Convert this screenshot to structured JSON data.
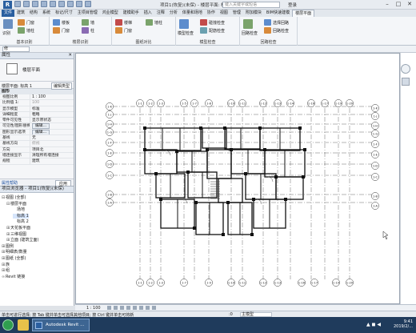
{
  "titlebar": {
    "logo": "R",
    "title": "项目1(恢复)(未保) - 楼层平面: 标高 1",
    "search_placeholder": "键入关键字或短语",
    "login": "登录",
    "min": "–",
    "max": "□",
    "close": "✕"
  },
  "ribbon_tabs": [
    "文件",
    "建筑",
    "结构",
    "系统",
    "插入",
    "注释",
    "分析",
    "体量和场地",
    "协作",
    "视图",
    "管理",
    "附加模块",
    "修改",
    "BIM模型",
    "楼层平面",
    "整合工具",
    "修改 | 楼层平面"
  ],
  "ribbon_tabs_fixed": [
    "文件",
    "建筑",
    "结构",
    "系统",
    "插入",
    "注释",
    "分析",
    "体量和场地",
    "协作",
    "视图",
    "管理",
    "附加模块",
    "修改"
  ],
  "ribbon_tabs_display": [
    "文件",
    "建筑",
    "结构",
    "系统",
    "标记/尺寸",
    "主项目管理",
    "鸿业模型",
    "建模助手",
    "插入",
    "注释",
    "分析",
    "体量和场地",
    "协作",
    "视图",
    "管理",
    "附加模块",
    "BIM快速建模",
    "楼层平面"
  ],
  "ribbon_groups": {
    "g1": "基本识别",
    "g2": "楼层识别",
    "g3": "图纸对比",
    "g4": "模型检查",
    "g5": "回路检查"
  },
  "ribbon_buttons": {
    "b1": "识别",
    "b2": "门窗",
    "b3": "墙柱",
    "b4": "楼板",
    "b5": "门窗",
    "b6": "墙",
    "b7": "柱",
    "b8": "楼梯",
    "b9": "门窗",
    "b10": "墙柱",
    "b11": "模型检查",
    "b12": "碰撞检查",
    "b13": "配筋检查",
    "b14": "回路检查",
    "b15": "选择回路",
    "b16": "回路检查"
  },
  "subbar": {
    "selector": "修"
  },
  "properties": {
    "title": "属性",
    "close": "✕",
    "type_name": "楼层平面",
    "view_select_label": "楼层平面: 标高 1",
    "edit_type": "编辑类型",
    "section_graphics": "图形",
    "rows": [
      {
        "k": "视图比例",
        "v": "1 : 100"
      },
      {
        "k": "比例值 1:",
        "v": "100"
      },
      {
        "k": "显示模型",
        "v": "标准"
      },
      {
        "k": "详细程度",
        "v": "粗略"
      },
      {
        "k": "零件可见性",
        "v": "显示原状态"
      },
      {
        "k": "可见性/图形替换",
        "v": "编辑..."
      },
      {
        "k": "图形显示选项",
        "v": "编辑..."
      },
      {
        "k": "基线",
        "v": "无"
      },
      {
        "k": "基线方向",
        "v": "俯视"
      },
      {
        "k": "方向",
        "v": "项目北"
      },
      {
        "k": "墙连接显示",
        "v": "清理所有墙连接"
      },
      {
        "k": "规程",
        "v": "建筑"
      }
    ],
    "help_link": "属性帮助",
    "apply": "应用"
  },
  "browser": {
    "title": "项目浏览器 - 项目1(恢复)(未保)",
    "items": [
      {
        "label": "视图 (全部)",
        "tg": "⊟"
      },
      {
        "label": "楼层平面",
        "tg": "⊟"
      },
      {
        "label": "场地",
        "tg": ""
      },
      {
        "label": "标高 1",
        "tg": ""
      },
      {
        "label": "标高 2",
        "tg": ""
      },
      {
        "label": "天花板平面",
        "tg": "⊞"
      },
      {
        "label": "三维视图",
        "tg": "⊞"
      },
      {
        "label": "立面 (建筑立面)",
        "tg": "⊞"
      },
      {
        "label": "图例",
        "tg": "⊞"
      },
      {
        "label": "明细表/数量",
        "tg": "⊞"
      },
      {
        "label": "图纸 (全部)",
        "tg": "⊞"
      },
      {
        "label": "族",
        "tg": "⊞"
      },
      {
        "label": "组",
        "tg": "⊞"
      },
      {
        "label": "Revit 链接",
        "tg": "∞"
      }
    ]
  },
  "viewbar": {
    "scale": "1 : 100"
  },
  "status": {
    "text": "单击可进行选择; 按 Tab 键并单击可选择其他项目; 按 Ctrl 键并单击可将新",
    "zero": ":0",
    "model": "主模型"
  },
  "taskbar": {
    "app2": "Autodesk Revit ...",
    "time": "9:41",
    "date": "2019/2/..."
  },
  "grid_labels": {
    "top": [
      "1-1",
      "1-2",
      "1-3",
      "1-5",
      "1-7",
      "1-8",
      "1-10",
      "1-11",
      "1-12",
      "1-13",
      "1-14",
      "1-16",
      "1-17",
      "1-19",
      "1-20"
    ],
    "bottom": [
      "1-1",
      "1-2",
      "1-3",
      "1-7",
      "1-9",
      "1-10",
      "1-11",
      "1-12",
      "1-13",
      "1-16",
      "1-17",
      "1-19",
      "1-20"
    ],
    "left": [
      "1-K",
      "1-J",
      "1-H",
      "1-G",
      "1-F",
      "1-E",
      "1-D",
      "1-C",
      "1-B",
      "1-A"
    ],
    "right": [
      "1-K",
      "1-J",
      "1-H",
      "1-G",
      "1-F",
      "1-E",
      "1-D",
      "1-C",
      "1-B",
      "1-A"
    ]
  },
  "colors": {
    "accent": "#2a5fa0",
    "canvas": "#ffffff",
    "taskbar": "#1f3b5c"
  }
}
